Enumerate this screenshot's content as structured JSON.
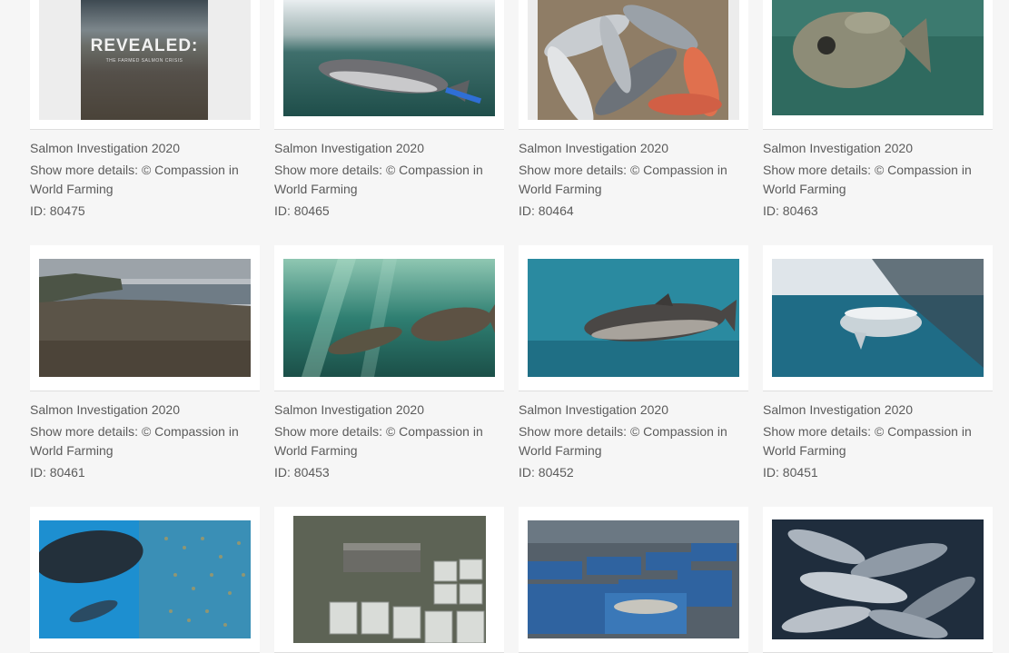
{
  "gallery": {
    "items": [
      {
        "title": "Salmon Investigation 2020",
        "details": "Show more details: © Compassion in World Farming",
        "id": "ID: 80475",
        "image": "cover-revealed-farmed-salmon-crisis",
        "overlay_title": "REVEALED:",
        "overlay_subtitle": "THE FARMED SALMON CRISIS"
      },
      {
        "title": "Salmon Investigation 2020",
        "details": "Show more details: © Compassion in World Farming",
        "id": "ID: 80465",
        "image": "salmon-at-water-surface"
      },
      {
        "title": "Salmon Investigation 2020",
        "details": "Show more details: © Compassion in World Farming",
        "id": "ID: 80464",
        "image": "dead-salmon-in-crate"
      },
      {
        "title": "Salmon Investigation 2020",
        "details": "Show more details: © Compassion in World Farming",
        "id": "ID: 80463",
        "image": "lumpfish-underwater"
      },
      {
        "title": "Salmon Investigation 2020",
        "details": "Show more details: © Compassion in World Farming",
        "id": "ID: 80461",
        "image": "coastal-cliffs-landscape"
      },
      {
        "title": "Salmon Investigation 2020",
        "details": "Show more details: © Compassion in World Farming",
        "id": "ID: 80453",
        "image": "two-salmon-underwater-sunrays"
      },
      {
        "title": "Salmon Investigation 2020",
        "details": "Show more details: © Compassion in World Farming",
        "id": "ID: 80452",
        "image": "salmon-swimming-blue-water"
      },
      {
        "title": "Salmon Investigation 2020",
        "details": "Show more details: © Compassion in World Farming",
        "id": "ID: 80451",
        "image": "salmon-below-net-pen"
      },
      {
        "title": "",
        "details": "",
        "id": "",
        "image": "salmon-by-netting"
      },
      {
        "title": "",
        "details": "",
        "id": "",
        "image": "containers-on-concrete"
      },
      {
        "title": "",
        "details": "",
        "id": "",
        "image": "blue-bins-at-dusk"
      },
      {
        "title": "",
        "details": "",
        "id": "",
        "image": "pile-of-dead-salmon"
      }
    ]
  },
  "colors": {
    "background": "#f6f6f6",
    "card": "#ffffff",
    "text": "#5b5b5b"
  }
}
